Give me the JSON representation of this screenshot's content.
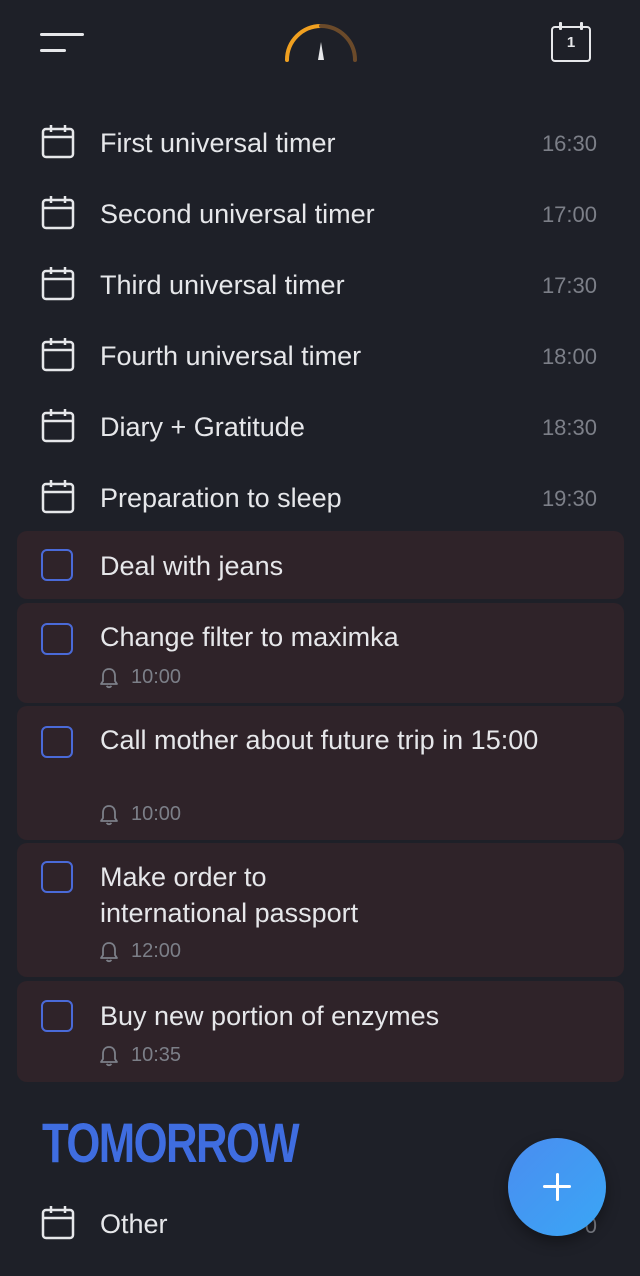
{
  "header": {
    "menu_icon": "hamburger-icon",
    "gauge_icon": "gauge-icon",
    "calendar_day": "1"
  },
  "timers": [
    {
      "title": "First universal timer",
      "time": "16:30"
    },
    {
      "title": "Second universal timer",
      "time": "17:00"
    },
    {
      "title": "Third universal timer",
      "time": "17:30"
    },
    {
      "title": "Fourth universal timer",
      "time": "18:00"
    },
    {
      "title": "Diary + Gratitude",
      "time": "18:30"
    },
    {
      "title": "Preparation to sleep",
      "time": "19:30"
    }
  ],
  "tasks": [
    {
      "title": "Deal with jeans",
      "reminder": ""
    },
    {
      "title": "Change filter to maximka",
      "reminder": "10:00"
    },
    {
      "title": "Call mother about future trip in 15:00",
      "reminder": "10:00"
    },
    {
      "title": "Make order to international passport",
      "reminder": "12:00"
    },
    {
      "title": "Buy new portion of enzymes",
      "reminder": "10:35"
    }
  ],
  "tomorrow": {
    "heading": "TOMORROW",
    "items": [
      {
        "title": "Other",
        "time": "0"
      }
    ]
  },
  "colors": {
    "background": "#1e2028",
    "task_card": "#2f2329",
    "accent": "#3f6de0",
    "gauge": "#f0a020"
  }
}
